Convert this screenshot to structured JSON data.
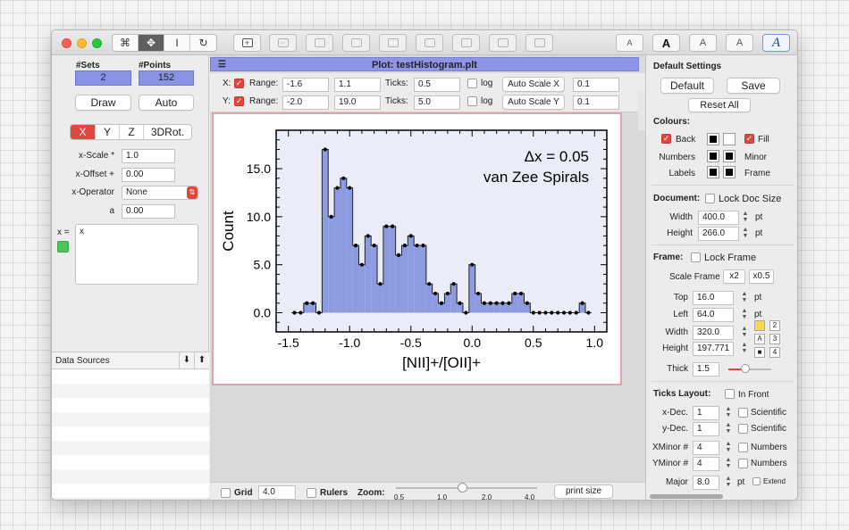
{
  "toolbar": {
    "tools": [
      "select-tool",
      "move-tool",
      "text-cursor-tool",
      "rotate-tool"
    ],
    "text_buttons": [
      "A",
      "A",
      "A",
      "A",
      "A"
    ]
  },
  "left": {
    "sets_label": "#Sets",
    "points_label": "#Points",
    "sets_value": "2",
    "points_value": "152",
    "draw_label": "Draw",
    "auto_label": "Auto",
    "axis_tabs": [
      "X",
      "Y",
      "Z",
      "3DRot."
    ],
    "xscale_label": "x-Scale *",
    "xscale_value": "1.0",
    "xoffset_label": "x-Offset +",
    "xoffset_value": "0.00",
    "xoperator_label": "x-Operator",
    "xoperator_value": "None",
    "a_label": "a",
    "a_value": "0.00",
    "x_eq_label": "x =",
    "x_expr": "x",
    "data_sources_label": "Data Sources"
  },
  "plot": {
    "title": "Plot: testHistogram.plt",
    "x_axis_label": "X:",
    "y_axis_label": "Y:",
    "range_label": "Range:",
    "x_min": "-1.6",
    "x_max": "1.1",
    "y_min": "-2.0",
    "y_max": "19.0",
    "ticks_label": "Ticks:",
    "x_ticks": "0.5",
    "y_ticks": "5.0",
    "log_label": "log",
    "auto_scale_x": "Auto Scale X",
    "auto_scale_y": "Auto Scale Y",
    "x_pad": "0.1",
    "y_pad": "0.1"
  },
  "bottom": {
    "grid_label": "Grid",
    "grid_value": "4.0",
    "rulers_label": "Rulers",
    "zoom_label": "Zoom:",
    "zoom_ticks": [
      "0.5",
      "1.0",
      "2.0",
      "4.0"
    ],
    "print_size_label": "print size"
  },
  "settings": {
    "title": "Default Settings",
    "default_label": "Default",
    "save_label": "Save",
    "reset_all_label": "Reset All",
    "colours_label": "Colours:",
    "back_label": "Back",
    "fill_label": "Fill",
    "numbers_label": "Numbers",
    "minor_label": "Minor",
    "labels_label": "Labels",
    "frame_color_label": "Frame",
    "document_label": "Document:",
    "lock_doc_size_label": "Lock Doc Size",
    "width_label": "Width",
    "width_value": "400.0",
    "height_label": "Height",
    "height_value": "266.0",
    "pt": "pt",
    "frame_label": "Frame:",
    "lock_frame_label": "Lock Frame",
    "scale_frame_label": "Scale Frame",
    "x2_label": "x2",
    "x05_label": "x0.5",
    "top_label": "Top",
    "top_value": "16.0",
    "left_label": "Left",
    "left_value": "64.0",
    "fwidth_label": "Width",
    "fwidth_value": "320.0",
    "fheight_label": "Height",
    "fheight_value": "197.771",
    "thick_label": "Thick",
    "thick_value": "1.5",
    "ticks_layout_label": "Ticks Layout:",
    "in_front_label": "In Front",
    "xdec_label": "x-Dec.",
    "xdec_value": "1",
    "ydec_label": "y-Dec.",
    "ydec_value": "1",
    "scientific_label": "Scientific",
    "xminor_label": "XMinor #",
    "xminor_value": "4",
    "yminor_label": "YMinor #",
    "yminor_value": "4",
    "numbers_cb_label": "Numbers",
    "major_label": "Major",
    "major_value": "8.0",
    "extend_label": "Extend",
    "grid_nums": [
      "2",
      "3",
      "4"
    ],
    "a_label": "A"
  },
  "chart_data": {
    "type": "bar",
    "title": "",
    "xlabel": "[NII]+/[OII]+",
    "ylabel": "Count",
    "xlim": [
      -1.6,
      1.1
    ],
    "ylim": [
      -2.0,
      19.0
    ],
    "xticks": [
      -1.5,
      -1.0,
      -0.5,
      0.0,
      0.5,
      1.0
    ],
    "xtick_labels": [
      "-1.5",
      "-1.0",
      "-0.5",
      "0.0",
      "0.5",
      "1.0"
    ],
    "yticks": [
      0,
      5,
      10,
      15
    ],
    "ytick_labels": [
      "0.0",
      "5.0",
      "10.0",
      "15.0"
    ],
    "bin_width": 0.05,
    "annotations": [
      "Δx = 0.05",
      "van Zee Spirals"
    ],
    "fill_color": "#8f9be0",
    "series": [
      {
        "x": [
          -1.45,
          -1.4,
          -1.35,
          -1.3,
          -1.25,
          -1.2,
          -1.15,
          -1.1,
          -1.05,
          -1.0,
          -0.95,
          -0.9,
          -0.85,
          -0.8,
          -0.75,
          -0.7,
          -0.65,
          -0.6,
          -0.55,
          -0.5,
          -0.45,
          -0.4,
          -0.35,
          -0.3,
          -0.25,
          -0.2,
          -0.15,
          -0.1,
          -0.05,
          0.0,
          0.05,
          0.1,
          0.15,
          0.2,
          0.25,
          0.3,
          0.35,
          0.4,
          0.45,
          0.5,
          0.55,
          0.6,
          0.65,
          0.7,
          0.75,
          0.8,
          0.85,
          0.9,
          0.95
        ],
        "y": [
          0,
          0,
          1,
          1,
          0,
          17,
          10,
          13,
          14,
          13,
          7,
          5,
          8,
          7,
          3,
          9,
          9,
          6,
          7,
          8,
          7,
          7,
          3,
          2,
          1,
          2,
          3,
          1,
          0,
          5,
          2,
          1,
          1,
          1,
          1,
          1,
          2,
          2,
          1,
          0,
          0,
          0,
          0,
          0,
          0,
          0,
          0,
          1,
          0
        ]
      }
    ]
  }
}
